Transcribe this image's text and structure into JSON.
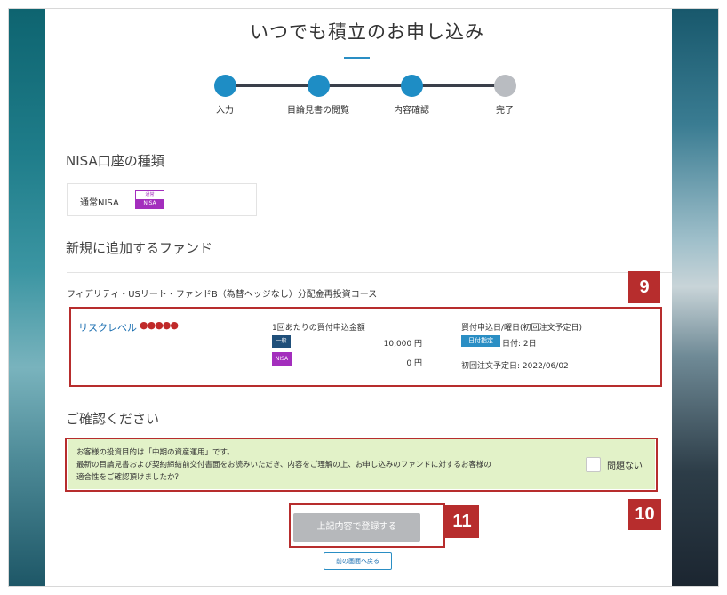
{
  "page": {
    "title": "いつでも積立のお申し込み"
  },
  "steps": [
    {
      "label": "入力",
      "active": true
    },
    {
      "label": "目論見書の閲覧",
      "active": true
    },
    {
      "label": "内容確認",
      "active": true
    },
    {
      "label": "完了",
      "active": false
    }
  ],
  "nisa_section": {
    "heading": "NISA口座の種類",
    "account_type": "通常NISA",
    "badge_top": "通常",
    "badge_bottom": "NISA"
  },
  "fund_section": {
    "heading": "新規に追加するファンド",
    "fund_name": "フィデリティ・USリート・ファンドB（為替ヘッジなし）分配金再投資コース",
    "risk_label": "リスクレベル",
    "risk_dots": "●●●●●",
    "amount_heading": "1回あたりの買付申込金額",
    "tag_normal": "一般",
    "amount_normal": "10,000 円",
    "tag_nisa": "NISA",
    "amount_nisa": "0 円",
    "date_heading": "買付申込日/曜日(初回注文予定日)",
    "date_tag": "日付指定",
    "date_value": "日付: 2日",
    "first_order": "初回注文予定日: 2022/06/02"
  },
  "confirm_section": {
    "heading": "ご確認ください",
    "line1": "お客様の投資目的は「中期の資産運用」です。",
    "line2": "最新の目論見書および契約締結前交付書面をお読みいただき、内容をご理解の上、お申し込みのファンドに対するお客様の",
    "line3": "適合性をご確認頂けましたか？",
    "checkbox_label": "問題ない"
  },
  "buttons": {
    "submit": "上記内容で登録する",
    "back": "前の画面へ戻る"
  },
  "markers": {
    "m9": "9",
    "m10": "10",
    "m11": "11"
  },
  "colors": {
    "accent": "#1e8dc5",
    "annotation": "#b72d2d",
    "nisa": "#a32ebd",
    "confirm_bg": "#e2f2c8"
  }
}
